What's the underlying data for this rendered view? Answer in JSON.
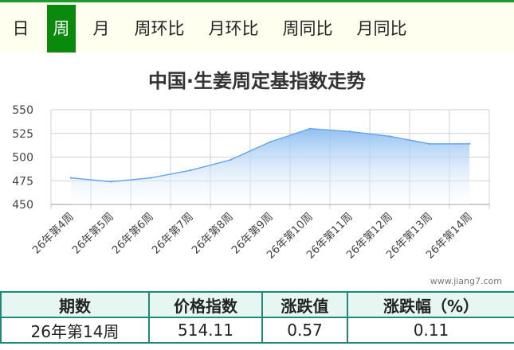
{
  "tabs": [
    "日",
    "周",
    "月",
    "周环比",
    "月环比",
    "周同比",
    "月同比"
  ],
  "active_tab": "周",
  "watermark": "www.jiang7.com",
  "colors": {
    "tab_active": "#0a8a0a",
    "header_border": "#1e9b2b",
    "line": "#6aa6e8",
    "area_top": "#8dbdf0",
    "table_border": "#1f8a7c"
  },
  "chart_data": {
    "type": "area",
    "title": "中国·生姜周定基指数走势",
    "xlabel": "",
    "ylabel": "",
    "categories": [
      "26年第4周",
      "26年第5周",
      "26年第6周",
      "26年第7周",
      "26年第8周",
      "26年第9周",
      "26年第10周",
      "26年第11周",
      "26年第12周",
      "26年第13周",
      "26年第14周"
    ],
    "values": [
      478,
      474,
      478,
      486,
      497,
      516,
      530,
      527,
      522,
      514,
      514.11
    ],
    "ylim": [
      450,
      550
    ],
    "yticks": [
      450,
      475,
      500,
      525,
      550
    ],
    "grid": true
  },
  "table": {
    "headers": [
      "期数",
      "价格指数",
      "涨跌值",
      "涨跌幅（%）"
    ],
    "row": [
      "26年第14周",
      "514.11",
      "0.57",
      "0.11"
    ]
  }
}
